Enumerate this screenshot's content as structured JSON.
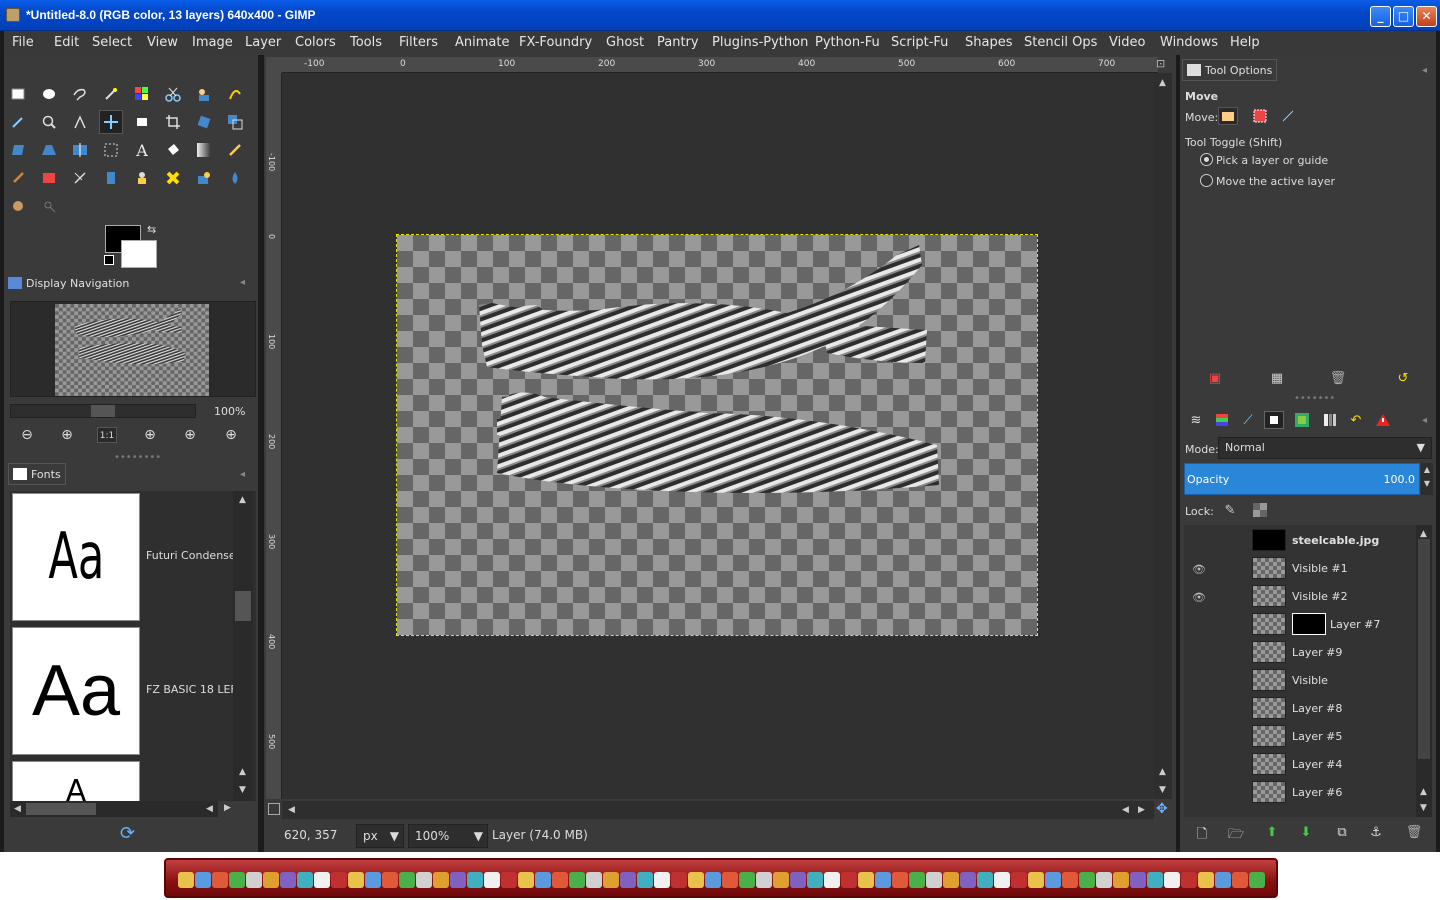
{
  "window": {
    "title": "*Untitled-8.0 (RGB color, 13 layers) 640x400 - GIMP",
    "minimize_label": "_",
    "maximize_label": "□",
    "close_label": "✕"
  },
  "menu": [
    "File",
    "Edit",
    "Select",
    "View",
    "Image",
    "Layer",
    "Colors",
    "Tools",
    "Filters",
    "Animate",
    "FX-Foundry",
    "Ghost",
    "Pantry",
    "Plugins-Python",
    "Python-Fu",
    "Script-Fu",
    "Shapes",
    "Stencil Ops",
    "Video",
    "Windows",
    "Help"
  ],
  "left_dock": {
    "display_navigation_tab": "Display Navigation",
    "nav_zoom": "100%",
    "fonts_tab": "Fonts",
    "fonts": [
      {
        "sample": "Aa",
        "name": "Futuri Condensed"
      },
      {
        "sample": "Aa",
        "name": "FZ BASIC 18 LEF"
      },
      {
        "sample": "A",
        "name": ""
      }
    ]
  },
  "ruler": {
    "top_labels": [
      "-100",
      "0",
      "100",
      "200",
      "300",
      "400",
      "500",
      "600",
      "700"
    ],
    "left_labels": [
      "-100",
      "0",
      "100",
      "200",
      "300",
      "400",
      "500"
    ]
  },
  "status": {
    "coords": "620, 357",
    "unit": "px",
    "zoom": "100%",
    "message": "Layer (74.0 MB)"
  },
  "tool_options": {
    "tab": "Tool Options",
    "heading": "Move",
    "move_label": "Move:",
    "toggle_label": "Tool Toggle  (Shift)",
    "option_pick": "Pick a layer or guide",
    "option_move_active": "Move the active layer"
  },
  "layers_panel": {
    "mode_label": "Mode:",
    "mode_value": "Normal",
    "opacity_label": "Opacity",
    "opacity_value": "100.0",
    "lock_label": "Lock:",
    "layers": [
      {
        "name": "steelcable.jpg",
        "visible": false,
        "bold": true,
        "thumb": "dark"
      },
      {
        "name": "Visible #1",
        "visible": true
      },
      {
        "name": "Visible #2",
        "visible": true
      },
      {
        "name": "Layer #7",
        "visible": false,
        "mask": true
      },
      {
        "name": "Layer #9",
        "visible": false
      },
      {
        "name": "Visible",
        "visible": false
      },
      {
        "name": "Layer #8",
        "visible": false
      },
      {
        "name": "Layer #5",
        "visible": false
      },
      {
        "name": "Layer #4",
        "visible": false
      },
      {
        "name": "Layer #6",
        "visible": false
      }
    ]
  },
  "colors": {
    "accent": "#2a86d8",
    "titlebar": "#0347c9",
    "selection_border": "#e6e600"
  }
}
